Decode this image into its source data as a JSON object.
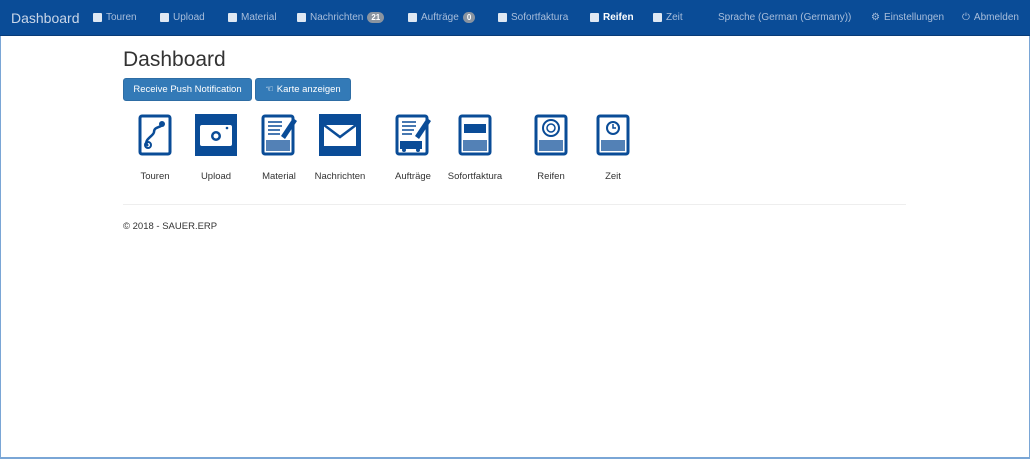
{
  "nav": {
    "brand": "Dashboard",
    "items": [
      {
        "label": "Touren",
        "icon": "route-icon"
      },
      {
        "label": "Upload",
        "icon": "camera-icon"
      },
      {
        "label": "Material",
        "icon": "material-icon"
      },
      {
        "label": "Nachrichten",
        "icon": "envelope-icon",
        "badge": "21"
      },
      {
        "label": "Aufträge",
        "icon": "orders-icon",
        "badge": "0"
      },
      {
        "label": "Sofortfaktura",
        "icon": "invoice-icon"
      },
      {
        "label": "Reifen",
        "icon": "tire-icon"
      },
      {
        "label": "Zeit",
        "icon": "clock-icon"
      }
    ],
    "language": "Sprache (German (Germany))",
    "settings": "Einstellungen",
    "logout": "Abmelden"
  },
  "page": {
    "title": "Dashboard",
    "push_button": "Receive Push Notification",
    "map_button": "Karte anzeigen"
  },
  "tiles": [
    "Touren",
    "Upload",
    "Material",
    "Nachrichten",
    "Aufträge",
    "Sofortfaktura",
    "Reifen",
    "Zeit"
  ],
  "footer": "© 2018 - SAUER.ERP",
  "colors": {
    "navbar": "#0a4c97",
    "button": "#337ab7",
    "icon": "#0a4c97"
  }
}
